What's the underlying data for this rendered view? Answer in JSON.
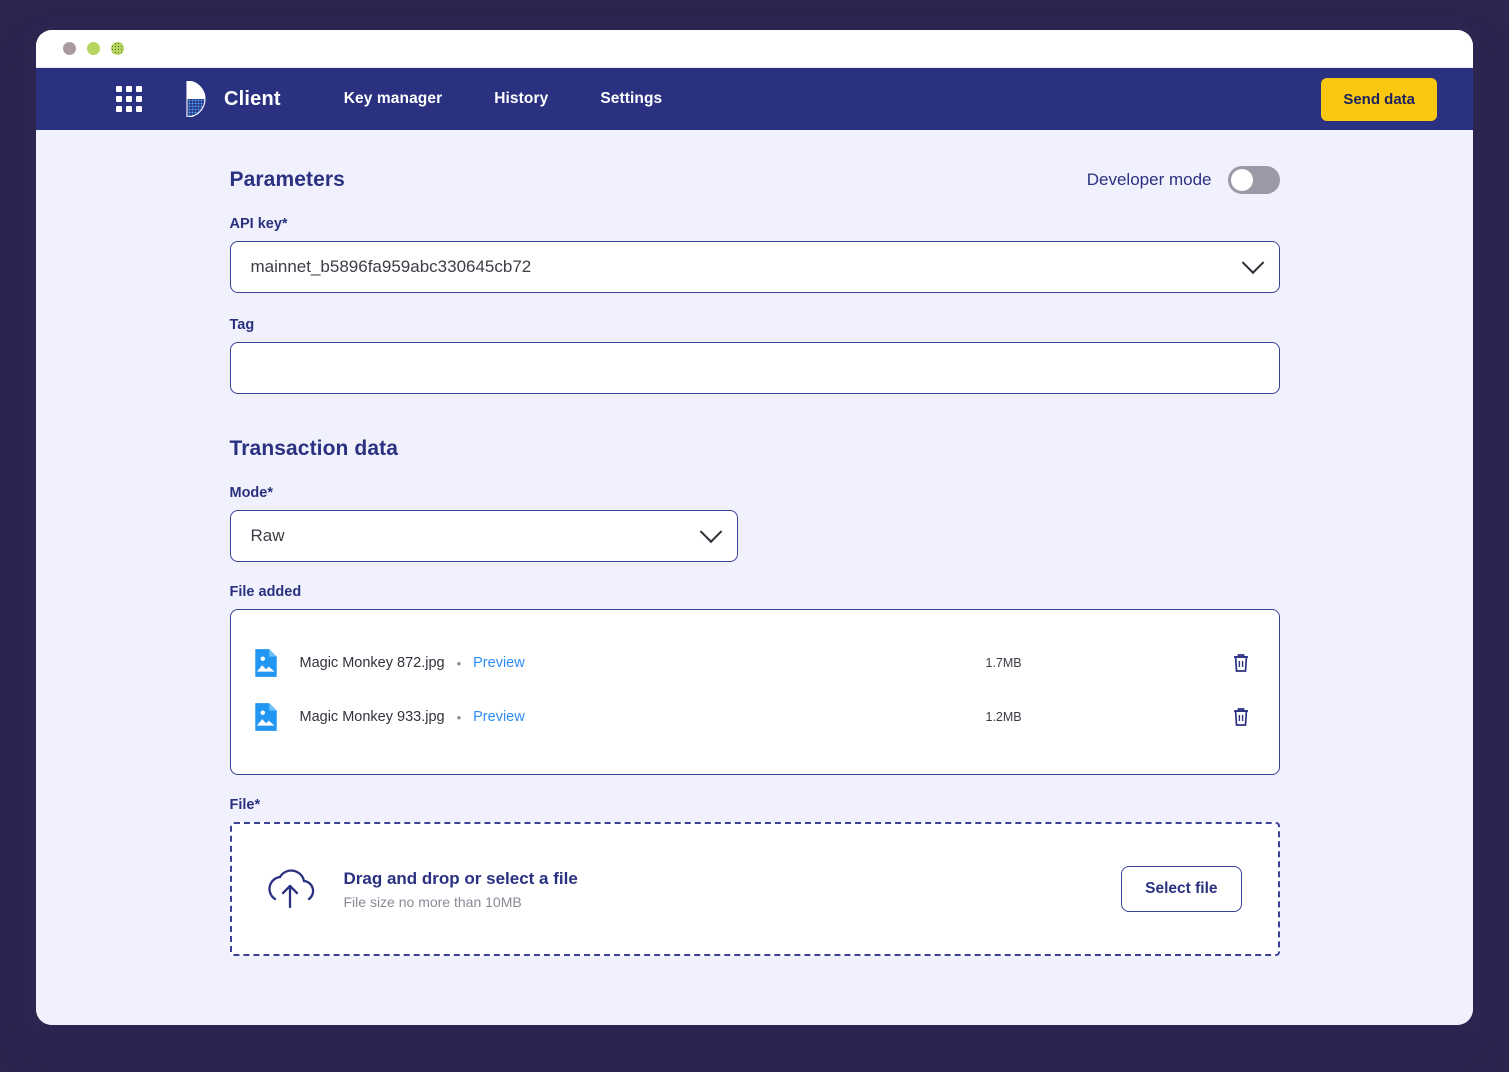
{
  "window": {
    "traffic_lights": [
      {
        "name": "close-dot",
        "color": "#a89aa0"
      },
      {
        "name": "minimize-dot",
        "color": "#b6d45f"
      },
      {
        "name": "maximize-dot",
        "color": "#b6d45f"
      }
    ]
  },
  "navbar": {
    "apps_icon": "apps-grid-icon",
    "brand_icon": "client-logo-icon",
    "brand": "Client",
    "links": [
      {
        "label": "Key manager"
      },
      {
        "label": "History"
      },
      {
        "label": "Settings"
      }
    ],
    "send_data_label": "Send data",
    "background": "#2a3180",
    "accent": "#fac711"
  },
  "parameters": {
    "title": "Parameters",
    "developer_mode_label": "Developer mode",
    "developer_mode_on": false,
    "api_key": {
      "label": "API key*",
      "value": "mainnet_b5896fa959abc330645cb72",
      "placeholder": "",
      "dropdown_icon": "chevron-down-icon"
    },
    "tag": {
      "label": "Tag",
      "value": "",
      "placeholder": ""
    }
  },
  "transaction_data": {
    "title": "Transaction data",
    "mode": {
      "label": "Mode*",
      "value": "Raw",
      "options": [
        "Raw"
      ],
      "dropdown_icon": "chevron-down-icon"
    },
    "file_added": {
      "label": "File added",
      "files": [
        {
          "icon": "image-file-icon",
          "name": "Magic Monkey 872.jpg",
          "separator": "•",
          "preview_label": "Preview",
          "size": "1.7MB",
          "delete_icon": "trash-icon"
        },
        {
          "icon": "image-file-icon",
          "name": "Magic Monkey 933.jpg",
          "separator": "•",
          "preview_label": "Preview",
          "size": "1.2MB",
          "delete_icon": "trash-icon"
        }
      ]
    },
    "file_upload": {
      "label": "File*",
      "icon": "upload-cloud-icon",
      "title": "Drag and drop or select a file",
      "subtitle": "File size no more than 10MB",
      "button_label": "Select file"
    }
  },
  "colors": {
    "brand_navy": "#2a3180",
    "page_background": "#f1f1fd",
    "border_navy": "#3b4296",
    "link_blue": "#2d8cf5",
    "accent_yellow": "#fac711",
    "outer_background": "#2b2550"
  }
}
